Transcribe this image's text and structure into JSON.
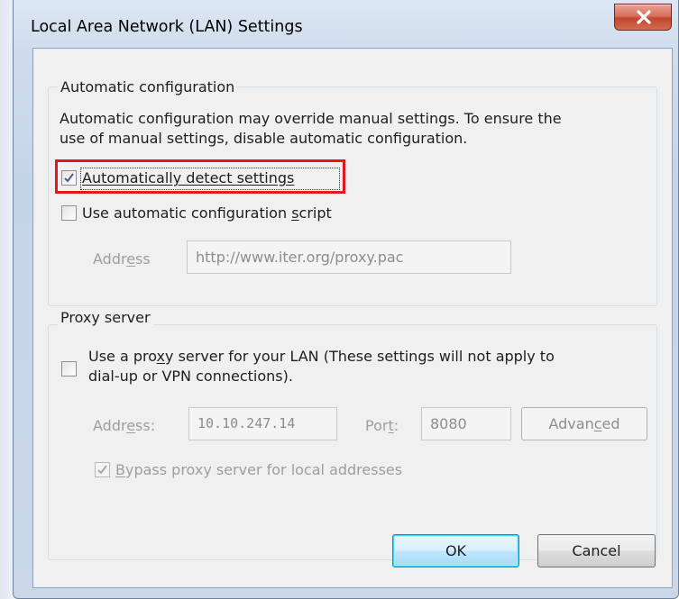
{
  "window": {
    "title": "Local Area Network (LAN) Settings",
    "close_icon": "close-icon",
    "close_color": "#c75050"
  },
  "auto_config": {
    "legend": "Automatic configuration",
    "description_line1": "Automatic configuration may override manual settings.  To ensure the",
    "description_line2": "use of manual settings, disable automatic configuration.",
    "detect": {
      "label": "Automatically detect settings",
      "checked": true
    },
    "script": {
      "label_before": "Use automatic configuration ",
      "label_mnemonic": "s",
      "label_after": "cript",
      "checked": false
    },
    "address": {
      "label_before": "Addr",
      "label_mnemonic": "e",
      "label_after": "ss",
      "value": "http://www.iter.org/proxy.pac"
    }
  },
  "proxy": {
    "legend": "Proxy server",
    "use_proxy": {
      "line1_before": "Use a pro",
      "line1_mnemonic": "x",
      "line1_after": "y server for your LAN (These settings will not apply to",
      "line2": "dial-up or VPN connections).",
      "checked": false
    },
    "address": {
      "label_before": "Addr",
      "label_mnemonic": "e",
      "label_after": "ss:",
      "value": "10.10.247.14"
    },
    "port": {
      "label_before": "Por",
      "label_mnemonic": "t",
      "label_after": ":",
      "value": "8080"
    },
    "advanced": {
      "label_before": "Advan",
      "label_mnemonic": "c",
      "label_after": "ed"
    },
    "bypass": {
      "label_mnemonic": "B",
      "label_after": "ypass proxy server for local addresses",
      "checked": true
    }
  },
  "buttons": {
    "ok": "OK",
    "cancel": "Cancel"
  },
  "colors": {
    "highlight": "#e0171b",
    "default_button": "#3c7fb1"
  }
}
